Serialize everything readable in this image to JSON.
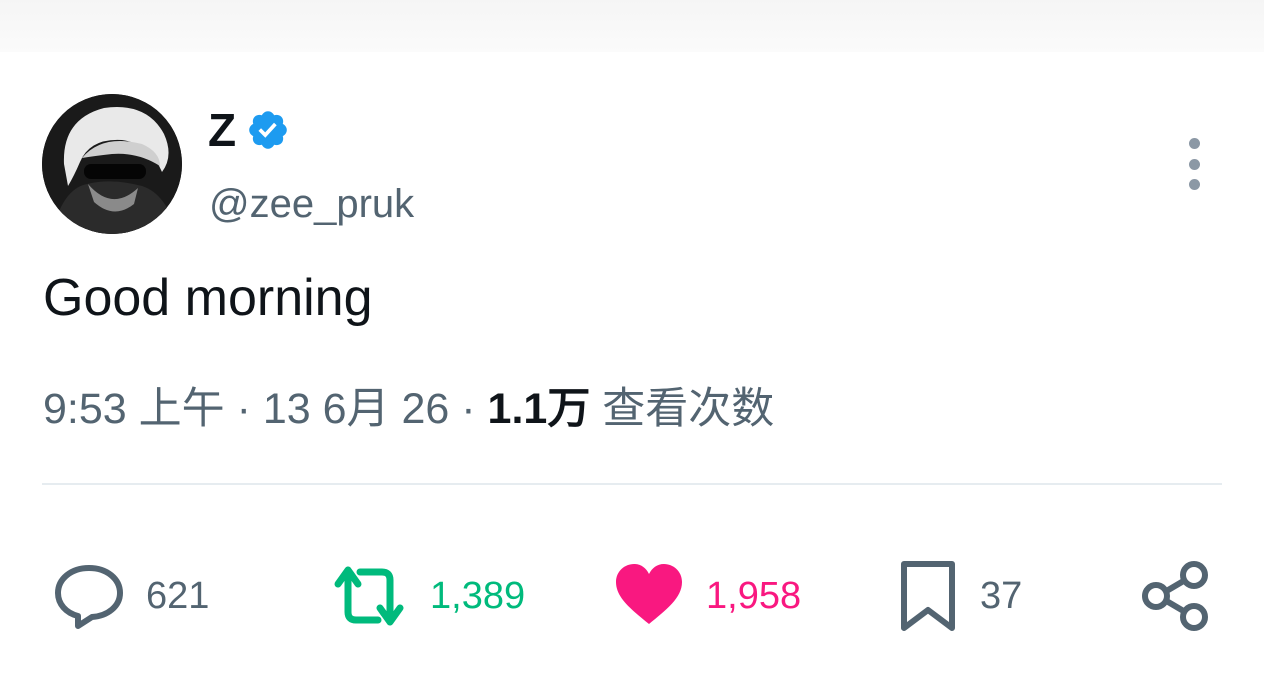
{
  "author": {
    "display_name": "Z",
    "handle": "@zee_pruk",
    "verified_icon": "verified-badge-icon"
  },
  "tweet": {
    "text": "Good morning",
    "time": "9:53 上午",
    "separator": " · ",
    "date": "13 6月 26",
    "views_count": "1.1万",
    "views_label": "查看次数"
  },
  "actions": {
    "reply": {
      "icon": "reply-icon",
      "count": "621"
    },
    "retweet": {
      "icon": "retweet-icon",
      "count": "1,389"
    },
    "like": {
      "icon": "heart-icon",
      "count": "1,958"
    },
    "bookmark": {
      "icon": "bookmark-icon",
      "count": "37"
    },
    "share": {
      "icon": "share-icon"
    }
  },
  "colors": {
    "verified": "#1d9bf0",
    "retweet": "#00ba7c",
    "like": "#f91880",
    "muted": "#536471",
    "text": "#0f1419"
  }
}
